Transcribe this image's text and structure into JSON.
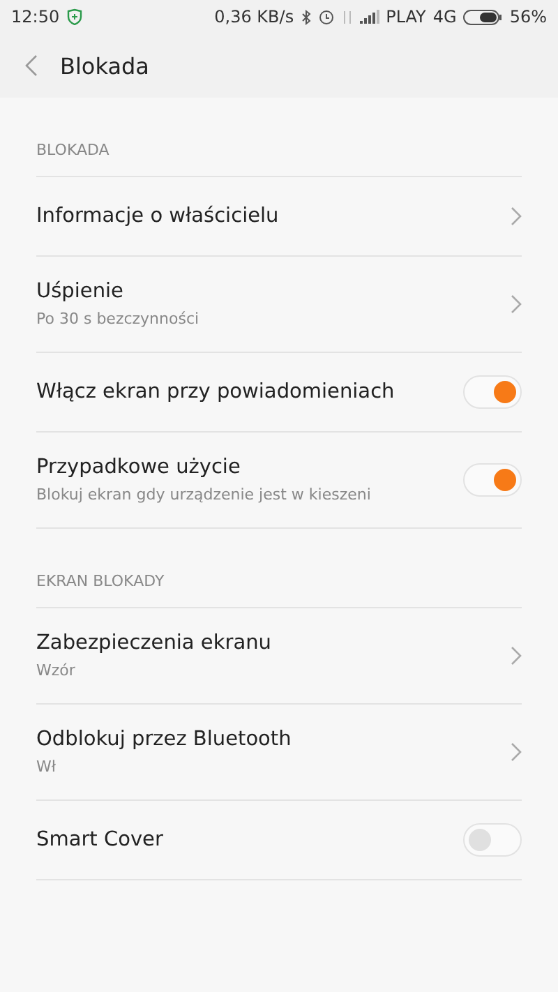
{
  "status_bar": {
    "time": "12:50",
    "speed": "0,36 KB/s",
    "carrier": "PLAY",
    "network": "4G",
    "battery": "56%"
  },
  "header": {
    "title": "Blokada"
  },
  "sections": [
    {
      "title": "BLOKADA",
      "items": [
        {
          "kind": "nav",
          "label": "Informacje o właścicielu"
        },
        {
          "kind": "nav",
          "label": "Uśpienie",
          "summary": "Po 30 s bezczynności"
        },
        {
          "kind": "toggle",
          "label": "Włącz ekran przy powiadomieniach",
          "on": true
        },
        {
          "kind": "toggle",
          "label": "Przypadkowe użycie",
          "summary": "Blokuj ekran gdy urządzenie jest w kieszeni",
          "on": true
        }
      ]
    },
    {
      "title": "EKRAN BLOKADY",
      "items": [
        {
          "kind": "nav",
          "label": "Zabezpieczenia ekranu",
          "summary": "Wzór"
        },
        {
          "kind": "nav",
          "label": "Odblokuj przez Bluetooth",
          "summary": "Wł"
        },
        {
          "kind": "toggle",
          "label": "Smart Cover",
          "on": false
        }
      ]
    }
  ]
}
